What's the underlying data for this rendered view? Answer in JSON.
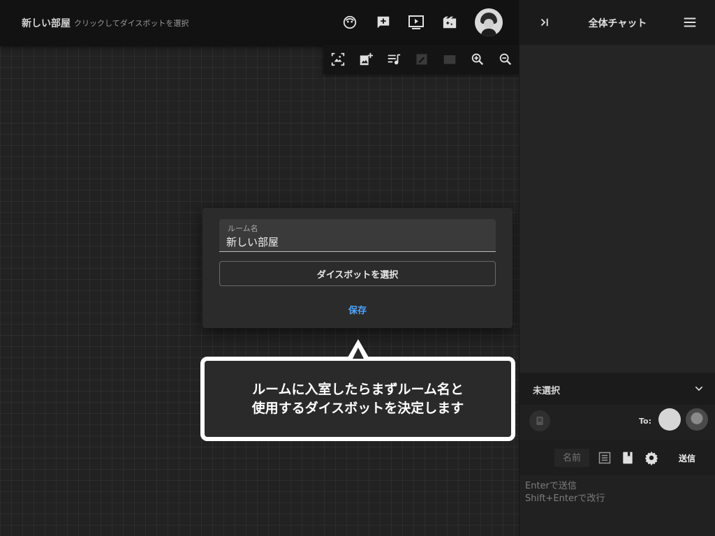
{
  "header": {
    "room_title": "新しい部屋",
    "room_hint": "クリックしてダイスボットを選択",
    "icons": [
      "face-icon",
      "add-comment-icon",
      "slideshow-icon",
      "movie-magic-icon"
    ]
  },
  "toolbar": {
    "icons": [
      "image-select-icon",
      "add-image-icon",
      "playlist-icon",
      "edit-box-icon",
      "movie-icon",
      "zoom-in-icon",
      "zoom-out-icon"
    ]
  },
  "dialog": {
    "room_name_label": "ルーム名",
    "room_name_value": "新しい部屋",
    "dicebot_button": "ダイスボットを選択",
    "save_button": "保存"
  },
  "callout": {
    "line1": "ルームに入室したらまずルーム名と",
    "line2": "使用するダイスボットを決定します"
  },
  "chat_panel": {
    "title": "全体チャット",
    "recipient": "未選択",
    "to_label": "To:",
    "name_placeholder": "名前",
    "send_button": "送信",
    "message_placeholder": "Enterで送信\nShift+Enterで改行"
  },
  "colors": {
    "accent": "#4da3ff",
    "board_bg": "#222222",
    "panel_bg": "#1f1f1f"
  }
}
